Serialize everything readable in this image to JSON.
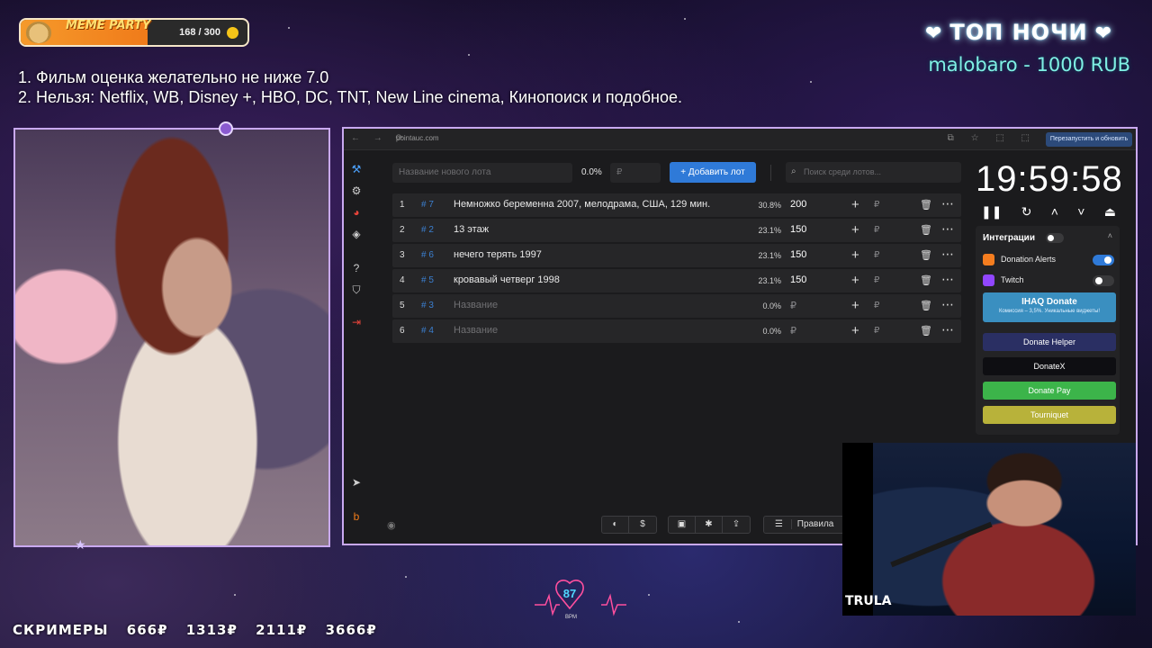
{
  "meme": {
    "title": "MEME PARTY",
    "count": "168 / 300",
    "progress": 0.56
  },
  "rules": {
    "line1": "1. Фильм оценка желательно не ниже 7.0",
    "line2": "2. Нельзя: Netflix, WB, Disney +, HBO, DC, TNT, New Line cinema, Кинопоиск и подобное."
  },
  "top": {
    "heart": "❤",
    "title": "ТОП НОЧИ",
    "donor": "malobaro - 1000 RUB"
  },
  "browser": {
    "url": "pointauc.com",
    "restart_label": "Перезапустить и обновить",
    "lot_placeholder": "Название нового лота",
    "lot_pct": "0.0%",
    "price_placeholder": "₽",
    "add_label": "Добавить лот",
    "search_placeholder": "Поиск среди лотов...",
    "lots": [
      {
        "n": "1",
        "id": "# 7",
        "name": "Немножко беременна 2007, мелодрама, США, 129 мин.",
        "pct": "30.8%",
        "amount": "200",
        "rub": "₽"
      },
      {
        "n": "2",
        "id": "# 2",
        "name": "13 этаж",
        "pct": "23.1%",
        "amount": "150",
        "rub": "₽"
      },
      {
        "n": "3",
        "id": "# 6",
        "name": "нечего терять 1997",
        "pct": "23.1%",
        "amount": "150",
        "rub": "₽"
      },
      {
        "n": "4",
        "id": "# 5",
        "name": "кровавый четверг 1998",
        "pct": "23.1%",
        "amount": "150",
        "rub": "₽"
      },
      {
        "n": "5",
        "id": "# 3",
        "name": "Название",
        "pct": "0.0%",
        "amount": "₽",
        "rub": "₽"
      },
      {
        "n": "6",
        "id": "# 4",
        "name": "Название",
        "pct": "0.0%",
        "amount": "₽",
        "rub": "₽"
      }
    ],
    "clock": "19:59:58",
    "rules_label": "Правила",
    "pct_label": "%"
  },
  "integrations": {
    "header": "Интеграции",
    "donation_alerts": "Donation Alerts",
    "twitch": "Twitch",
    "ihaq_title": "IHAQ Donate",
    "ihaq_sub": "Комиссия – 3,5%. Уникальные виджеты!",
    "donate_helper": "Donate Helper",
    "donatex": "DonateX",
    "donate_pay": "Donate Pay",
    "tourniquet": "Tourniquet"
  },
  "video": {
    "brand": "TRULA"
  },
  "heart_rate": {
    "bpm": "87",
    "label": "BPM"
  },
  "screamers": {
    "label": "СКРИМЕРЫ",
    "values": [
      "666₽",
      "1313₽",
      "2111₽",
      "3666₽"
    ]
  },
  "colors": {
    "accent": "#2f7ad8",
    "frame": "#c9a9f0",
    "donor": "#7ff0e4"
  }
}
